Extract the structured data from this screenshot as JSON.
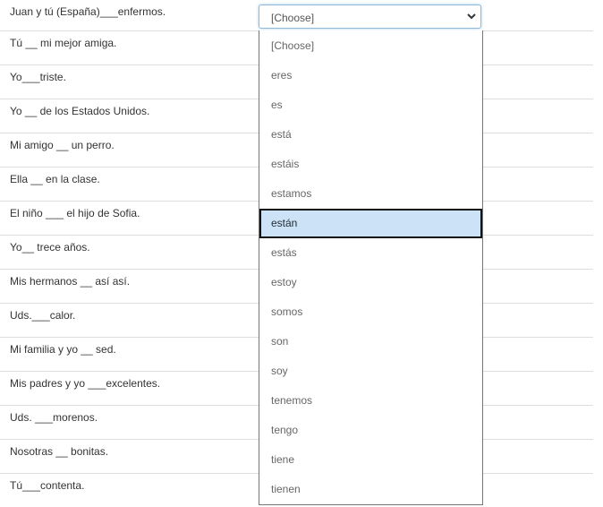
{
  "questions": [
    "Juan y tú (España)___enfermos.",
    "Tú __ mi mejor amiga.",
    "Yo___triste.",
    "Yo __ de los Estados Unidos.",
    "Mi amigo __ un perro.",
    "Ella __ en la clase.",
    "El niño ___ el hijo de Sofia.",
    "Yo__ trece años.",
    "Mis hermanos __ así así.",
    "Uds.___calor.",
    "Mi familia y yo __ sed.",
    "Mis padres y yo ___excelentes.",
    "Uds. ___morenos.",
    "Nosotras __ bonitas.",
    "Tú___contenta."
  ],
  "select": {
    "value": "[Choose]"
  },
  "options": [
    "[Choose]",
    "eres",
    "es",
    "está",
    "estáis",
    "estamos",
    "están",
    "estás",
    "estoy",
    "somos",
    "son",
    "soy",
    "tenemos",
    "tengo",
    "tiene",
    "tienen"
  ],
  "highlighted_option": "están"
}
